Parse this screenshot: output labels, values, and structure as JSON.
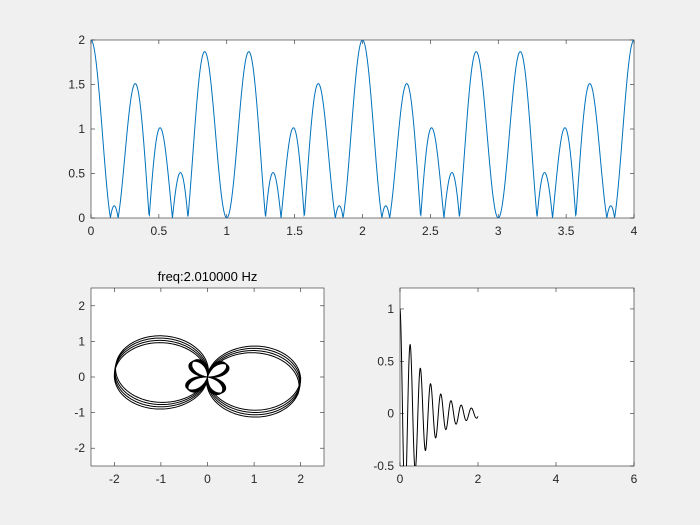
{
  "window": {
    "background": "#f0f0f0"
  },
  "chart_data": [
    {
      "type": "line",
      "title": "",
      "xlabel": "",
      "ylabel": "",
      "xlim": [
        0,
        4
      ],
      "ylim": [
        0,
        2
      ],
      "xticks": [
        0,
        0.5,
        1,
        1.5,
        2,
        2.5,
        3,
        3.5,
        4
      ],
      "xtick_labels": [
        "0",
        "0.5",
        "1",
        "1.5",
        "2",
        "2.5",
        "3",
        "3.5",
        "4"
      ],
      "yticks": [
        0,
        0.5,
        1,
        1.5,
        2
      ],
      "ytick_labels": [
        "0",
        "0.5",
        "1",
        "1.5",
        "2"
      ],
      "grid": false,
      "color": "#0072bd",
      "series": [
        {
          "function": "|cos(pi*x) + cos(6*pi*x)|",
          "x_range": [
            0,
            4
          ],
          "samples": 1200
        }
      ]
    },
    {
      "type": "line",
      "title": "freq:2.010000 Hz",
      "xlabel": "",
      "ylabel": "",
      "xlim": [
        -2.5,
        2.5
      ],
      "ylim": [
        -2.5,
        2.5
      ],
      "xticks": [
        -2,
        -1,
        0,
        1,
        2
      ],
      "xtick_labels": [
        "-2",
        "-1",
        "0",
        "1",
        "2"
      ],
      "yticks": [
        -2,
        -1,
        0,
        1,
        2
      ],
      "ytick_labels": [
        "-2",
        "-1",
        "0",
        "1",
        "2"
      ],
      "grid": false,
      "color": "#000000",
      "series": [
        {
          "kind": "winding",
          "signal": "cos(2*pi*t) + cos(6*pi*t)",
          "winding_freq_hz": 2.01,
          "t_range": [
            0,
            4
          ],
          "samples": 3000
        }
      ]
    },
    {
      "type": "line",
      "title": "",
      "xlabel": "",
      "ylabel": "",
      "xlim": [
        0,
        6
      ],
      "ylim": [
        -0.5,
        1.2
      ],
      "xticks": [
        0,
        2,
        4,
        6
      ],
      "xtick_labels": [
        "0",
        "2",
        "4",
        "6"
      ],
      "yticks": [
        -0.5,
        0,
        0.5,
        1
      ],
      "ytick_labels": [
        "-0.5",
        "0",
        "0.5",
        "1"
      ],
      "grid": false,
      "color": "#000000",
      "series": [
        {
          "function": "exp(-1.6*x) * cos(24*x)",
          "x_range": [
            0,
            2
          ],
          "samples": 600
        }
      ]
    }
  ]
}
